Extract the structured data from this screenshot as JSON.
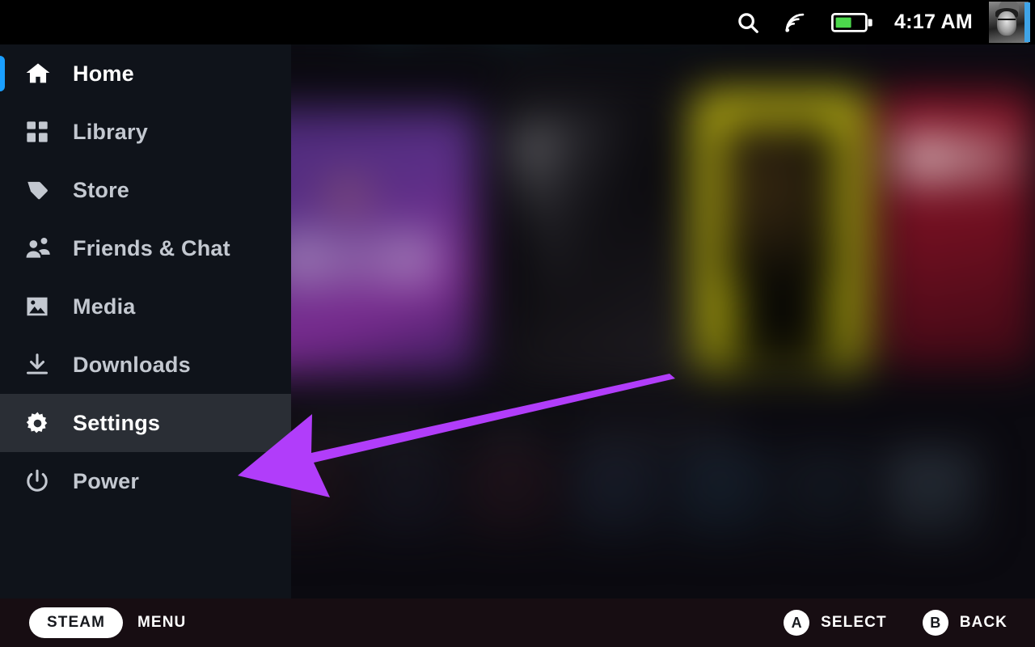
{
  "statusbar": {
    "search_icon": "search-icon",
    "signal_icon": "wifi-signal-icon",
    "battery_icon": "battery-icon",
    "battery_level_percent": 55,
    "time": "4:17 AM",
    "avatar_icon": "user-avatar",
    "avatar_status_color": "#3fa4e8"
  },
  "sidebar": {
    "items": [
      {
        "label": "Home",
        "icon": "home-icon",
        "state": "focused",
        "indicator": true
      },
      {
        "label": "Library",
        "icon": "library-icon",
        "state": "normal",
        "indicator": false
      },
      {
        "label": "Store",
        "icon": "store-tag-icon",
        "state": "normal",
        "indicator": false
      },
      {
        "label": "Friends & Chat",
        "icon": "friends-icon",
        "state": "normal",
        "indicator": false
      },
      {
        "label": "Media",
        "icon": "media-icon",
        "state": "normal",
        "indicator": false
      },
      {
        "label": "Downloads",
        "icon": "download-icon",
        "state": "normal",
        "indicator": false
      },
      {
        "label": "Settings",
        "icon": "gear-icon",
        "state": "selected",
        "indicator": false
      },
      {
        "label": "Power",
        "icon": "power-icon",
        "state": "normal",
        "indicator": false
      }
    ],
    "accent_color": "#1a9fff",
    "selected_row_color": "#2a2e35",
    "background_color": "#0f131a"
  },
  "footer": {
    "steam_label": "STEAM",
    "menu_label": "MENU",
    "hints": [
      {
        "button": "A",
        "label": "SELECT"
      },
      {
        "button": "B",
        "label": "BACK"
      }
    ]
  },
  "annotation": {
    "type": "arrow",
    "color": "#b13dfa",
    "points_to": "Settings"
  }
}
